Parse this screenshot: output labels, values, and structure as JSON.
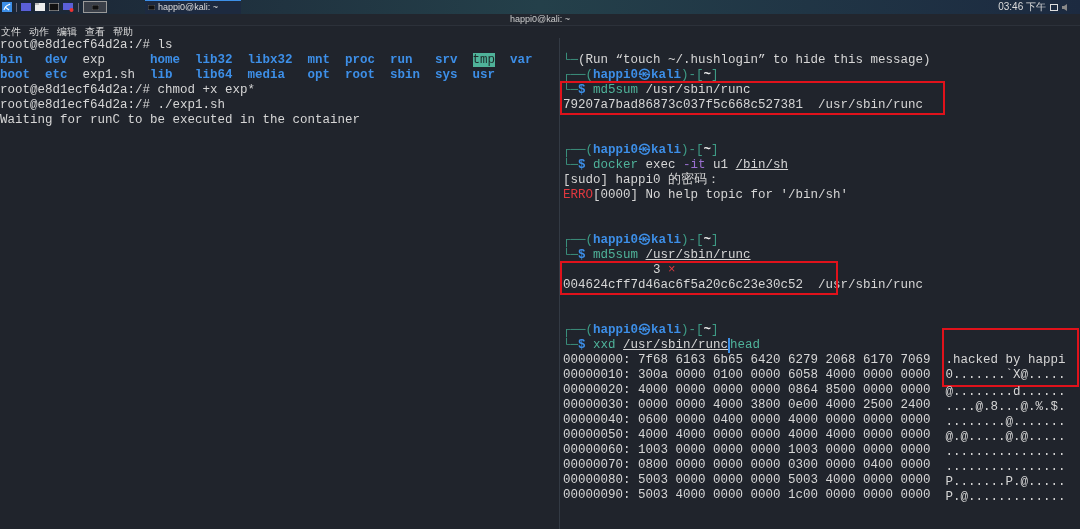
{
  "taskbar": {
    "window_task": {
      "title": "happi0@kali: ~",
      "selected": true
    },
    "clock": "03:46 下午"
  },
  "window": {
    "title": "happi0@kali: ~",
    "menu": [
      "文件",
      "动作",
      "编辑",
      "查看",
      "帮助"
    ]
  },
  "left_pane": {
    "lines": [
      {
        "kind": "text",
        "segments": [
          {
            "text": "root@e8d1ecf64d2a:/# ls",
            "kind": "plain"
          }
        ]
      },
      {
        "kind": "ls",
        "entries": [
          {
            "name": "bin",
            "kind": "dir"
          },
          {
            "name": "dev",
            "kind": "dir"
          },
          {
            "name": "exp",
            "kind": "file"
          },
          {
            "name": "home",
            "kind": "dir"
          },
          {
            "name": "lib32",
            "kind": "dir"
          },
          {
            "name": "libx32",
            "kind": "dir"
          },
          {
            "name": "mnt",
            "kind": "dir"
          },
          {
            "name": "proc",
            "kind": "dir"
          },
          {
            "name": "run",
            "kind": "dir"
          },
          {
            "name": "srv",
            "kind": "dir"
          },
          {
            "name": "tmp",
            "kind": "sticky"
          },
          {
            "name": "var",
            "kind": "dir"
          }
        ]
      },
      {
        "kind": "ls",
        "entries": [
          {
            "name": "boot",
            "kind": "dir"
          },
          {
            "name": "etc",
            "kind": "dir"
          },
          {
            "name": "exp1.sh",
            "kind": "file"
          },
          {
            "name": "lib",
            "kind": "dir"
          },
          {
            "name": "lib64",
            "kind": "dir"
          },
          {
            "name": "media",
            "kind": "dir"
          },
          {
            "name": "opt",
            "kind": "dir"
          },
          {
            "name": "root",
            "kind": "dir"
          },
          {
            "name": "sbin",
            "kind": "dir"
          },
          {
            "name": "sys",
            "kind": "dir"
          },
          {
            "name": "usr",
            "kind": "dir"
          }
        ]
      },
      {
        "kind": "text",
        "segments": [
          {
            "text": "root@e8d1ecf64d2a:/# chmod +x exp*",
            "kind": "plain"
          }
        ]
      },
      {
        "kind": "text",
        "segments": [
          {
            "text": "root@e8d1ecf64d2a:/# ./exp1.sh",
            "kind": "plain"
          }
        ]
      },
      {
        "kind": "text",
        "segments": [
          {
            "text": "Waiting for runC to be executed in the container",
            "kind": "plain"
          }
        ]
      }
    ]
  },
  "right_pane": {
    "blocks": [
      {
        "highlighted": false,
        "lines": [
          {
            "kind": "blank"
          },
          {
            "kind": "text",
            "segments": [
              {
                "text": "└─",
                "kind": "frame"
              },
              {
                "text": "(Run “touch ~/.hushlogin” to hide this message)",
                "kind": "plain"
              }
            ]
          },
          {
            "kind": "text",
            "segments": [
              {
                "text": "┌──(",
                "kind": "frame"
              },
              {
                "text": "happi0㉿kali",
                "kind": "user"
              },
              {
                "text": ")-[",
                "kind": "frame"
              },
              {
                "text": "~",
                "kind": "dir"
              },
              {
                "text": "]",
                "kind": "frame"
              }
            ]
          }
        ]
      },
      {
        "highlighted": true,
        "lines": [
          {
            "kind": "text",
            "segments": [
              {
                "text": "└─",
                "kind": "frame"
              },
              {
                "text": "$ ",
                "kind": "dollar"
              },
              {
                "text": "md5sum",
                "kind": "cmd"
              },
              {
                "text": " /usr/sbin/runc",
                "kind": "plain"
              }
            ]
          },
          {
            "kind": "text",
            "segments": [
              {
                "text": "79207a7bad86873c037f5c668c527381  /usr/sbin/runc",
                "kind": "plain"
              }
            ]
          }
        ]
      },
      {
        "highlighted": false,
        "lines": [
          {
            "kind": "blank"
          },
          {
            "kind": "blank"
          },
          {
            "kind": "text",
            "segments": [
              {
                "text": "┌──(",
                "kind": "frame"
              },
              {
                "text": "happi0㉿kali",
                "kind": "user"
              },
              {
                "text": ")-[",
                "kind": "frame"
              },
              {
                "text": "~",
                "kind": "dir"
              },
              {
                "text": "]",
                "kind": "frame"
              }
            ]
          },
          {
            "kind": "text",
            "segments": [
              {
                "text": "└─",
                "kind": "frame"
              },
              {
                "text": "$ ",
                "kind": "dollar"
              },
              {
                "text": "docker",
                "kind": "cmd"
              },
              {
                "text": " exec ",
                "kind": "plain"
              },
              {
                "text": "-it",
                "kind": "flag"
              },
              {
                "text": " u1 ",
                "kind": "plain"
              },
              {
                "text": "/bin/sh",
                "kind": "path"
              }
            ]
          },
          {
            "kind": "text",
            "segments": [
              {
                "text": "[sudo] happi0 的密码：",
                "kind": "plain"
              }
            ]
          },
          {
            "kind": "text",
            "segments": [
              {
                "text": "ERRO",
                "kind": "error"
              },
              {
                "text": "[0000] No help topic for '/bin/sh'",
                "kind": "plain"
              }
            ]
          },
          {
            "kind": "blank"
          },
          {
            "kind": "blank"
          },
          {
            "kind": "text",
            "segments": [
              {
                "text": "┌──(",
                "kind": "frame"
              },
              {
                "text": "happi0㉿kali",
                "kind": "user"
              },
              {
                "text": ")-[",
                "kind": "frame"
              },
              {
                "text": "~",
                "kind": "dir"
              },
              {
                "text": "]",
                "kind": "frame"
              }
            ]
          },
          {
            "kind": "text",
            "segments": [
              {
                "text": "└─",
                "kind": "frame"
              },
              {
                "text": "$ ",
                "kind": "dollar"
              },
              {
                "text": "md5sum ",
                "kind": "cmd"
              },
              {
                "text": "/usr/sbin/runc",
                "kind": "path"
              }
            ]
          }
        ]
      },
      {
        "highlighted": true,
        "lines": [
          {
            "kind": "text",
            "segments": [
              {
                "text": "            3 ",
                "kind": "plain"
              },
              {
                "text": "×",
                "kind": "error"
              }
            ]
          },
          {
            "kind": "text",
            "segments": [
              {
                "text": "004624cff7d46ac6f5a20c6c23e30c52  /usr/sbin/runc",
                "kind": "plain"
              }
            ]
          }
        ]
      },
      {
        "highlighted": false,
        "lines": [
          {
            "kind": "blank"
          },
          {
            "kind": "blank"
          },
          {
            "kind": "text",
            "segments": [
              {
                "text": "┌──(",
                "kind": "frame"
              },
              {
                "text": "happi0㉿kali",
                "kind": "user"
              },
              {
                "text": ")-[",
                "kind": "frame"
              },
              {
                "text": "~",
                "kind": "dir"
              },
              {
                "text": "]",
                "kind": "frame"
              }
            ]
          }
        ]
      }
    ],
    "xxd": {
      "command": [
        {
          "text": "└─",
          "kind": "frame"
        },
        {
          "text": "$ ",
          "kind": "dollar"
        },
        {
          "text": "xxd ",
          "kind": "cmd"
        },
        {
          "text": "/usr/sbin/runc",
          "kind": "path"
        },
        {
          "text": "head",
          "kind": "cmd",
          "cursor": true
        }
      ],
      "rows": [
        {
          "offset": "00000000:",
          "hex": "7f68 6163 6b65 6420 6279 2068 6170 7069",
          "ascii": ".hacked by happi",
          "highlighted": true
        },
        {
          "offset": "00000010:",
          "hex": "300a 0000 0100 0000 6058 4000 0000 0000",
          "ascii": "0.......`X@.....",
          "highlighted": true
        },
        {
          "offset": "00000020:",
          "hex": "4000 0000 0000 0000 0864 8500 0000 0000",
          "ascii": "@........d......",
          "highlighted": false
        },
        {
          "offset": "00000030:",
          "hex": "0000 0000 4000 3800 0e00 4000 2500 2400",
          "ascii": "....@.8...@.%.$.",
          "highlighted": false
        },
        {
          "offset": "00000040:",
          "hex": "0600 0000 0400 0000 4000 0000 0000 0000",
          "ascii": "........@.......",
          "highlighted": false
        },
        {
          "offset": "00000050:",
          "hex": "4000 4000 0000 0000 4000 4000 0000 0000",
          "ascii": "@.@.....@.@.....",
          "highlighted": false
        },
        {
          "offset": "00000060:",
          "hex": "1003 0000 0000 0000 1003 0000 0000 0000",
          "ascii": "................",
          "highlighted": false
        },
        {
          "offset": "00000070:",
          "hex": "0800 0000 0000 0000 0300 0000 0400 0000",
          "ascii": "................",
          "highlighted": false
        },
        {
          "offset": "00000080:",
          "hex": "5003 0000 0000 0000 5003 4000 0000 0000",
          "ascii": "P.......P.@.....",
          "highlighted": false
        },
        {
          "offset": "00000090:",
          "hex": "5003 4000 0000 0000 1c00 0000 0000 0000",
          "ascii": "P.@.............",
          "highlighted": false
        }
      ]
    }
  }
}
